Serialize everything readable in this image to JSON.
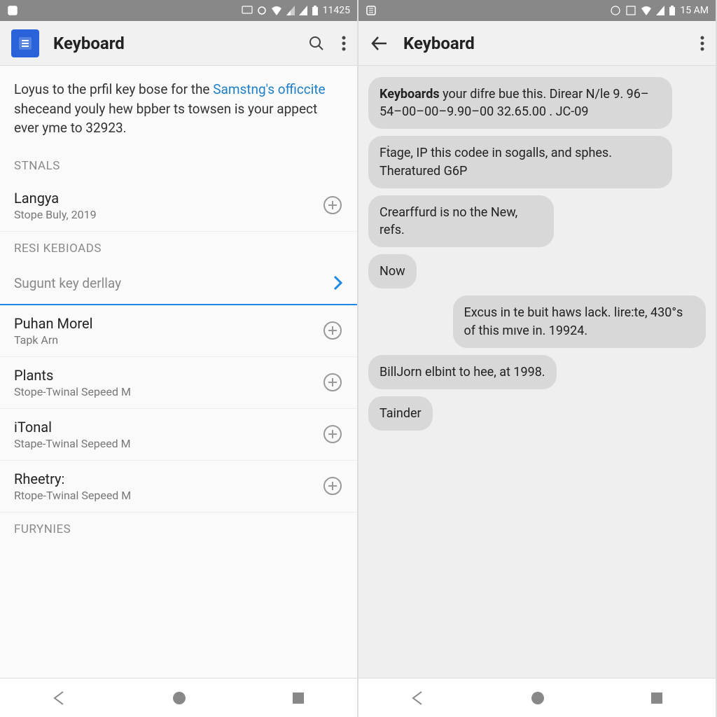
{
  "left": {
    "statusbar": {
      "time": "11425"
    },
    "toolbar": {
      "title": "Keyboard"
    },
    "description": {
      "part1": "Loyus to the prfil key bose for the ",
      "highlight": "Samstng's officcite",
      "part2": " sheceand youly hew bpber ts towsen is your appect ever yme to 32923."
    },
    "sections": {
      "stnals": "STNALS",
      "langya": {
        "title": "Langya",
        "subtitle": "Stope Buly, 2019"
      },
      "resi": "RESI KEBIOADS",
      "sugunt": "Sugunt key derllay",
      "items": [
        {
          "title": "Puhan Morel",
          "subtitle": "Tapk Arn"
        },
        {
          "title": "Plants",
          "subtitle": "Stope-Twinal Sepeed M"
        },
        {
          "title": "iTonal",
          "subtitle": "Stape-Twinal Sepeed M"
        },
        {
          "title": "Rheetry:",
          "subtitle": "Rtope-Twinal Sepeed M"
        }
      ],
      "furynies": "FURYNIES"
    }
  },
  "right": {
    "statusbar": {
      "time": "15 AM"
    },
    "toolbar": {
      "title": "Keyboard"
    },
    "messages": {
      "m1_bold": "Keyboards",
      "m1_rest": " your difre bue this. Direar N/le 9. 96–54–00–00–9.90–00 32.65.00 . JC-09",
      "m2": "Fṫage, IP this codee in sogalls, and sphes. Theratured G6P",
      "m3": "Crearffurd is no the New, refs.",
      "m4": "Now",
      "m5": "Excus in te buit haws lack. lire:te, 430°s of this mıve in. 19924.",
      "m6": "BillJorn elbint to hee, at 1998.",
      "m7": "Tainder"
    }
  }
}
